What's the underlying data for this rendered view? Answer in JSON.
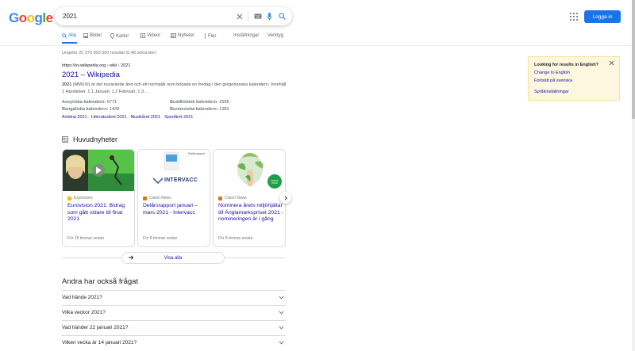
{
  "header": {
    "logo": [
      "G",
      "o",
      "o",
      "g",
      "l",
      "e"
    ],
    "logo_colors": [
      "#4285f4",
      "#ea4335",
      "#fbbc05",
      "#4285f4",
      "#34a853",
      "#ea4335"
    ],
    "query": "2021",
    "login_label": "Logga in"
  },
  "tabs": {
    "all": "Alla",
    "images": "Bilder",
    "maps": "Kartor",
    "videos": "Videor",
    "news": "Nyheter",
    "more": "Fler",
    "settings": "Inställningar",
    "tools": "Verktyg"
  },
  "stats": "Ungefär 25 270 000 000 resultat (0,48 sekunder)",
  "result": {
    "cite": "https://sv.wikipedia.org › wiki › 2021",
    "title": "2021 – Wikipedia",
    "snippet_bold": "2021",
    "snippet": " (MMXXI) är det nuvarande året och ett normalår som började en fredag i den gregorianska kalendern. Innehåll. 1 Händelser. 1.1 Januari; 1.2 Februari; 1.3 ...",
    "facts": [
      {
        "k": "Assyriska kalendern:",
        "v": "6771"
      },
      {
        "k": "Buddhistisk kalendern:",
        "v": "2565"
      },
      {
        "k": "Bengaliska kalendern:",
        "v": "1428"
      },
      {
        "k": "Burmesiska kalendern:",
        "v": "1383"
      }
    ],
    "sitelinks": [
      "Avlidna 2021",
      "Litteraturåret 2021",
      "Musikåret 2021",
      "Sportåret 2021"
    ],
    "sep": " · "
  },
  "top_stories": {
    "title": "Huvudnyheter",
    "cards": [
      {
        "source": "Expressen",
        "title": "Eurovision 2021: Bidrag som gått vidare till final 2021",
        "time": "För 15 timmar sedan"
      },
      {
        "source": "Cision News",
        "title": "Delårsrapport januari – mars 2021 - Intervacc",
        "time": "För 8 timmar sedan",
        "thumb_text": "INTERVACC",
        "thumb_small": "Delårsrapport"
      },
      {
        "source": "Cision News",
        "title": "Nominera årets miljöhjältar till Änglamarkspriset 2021 - nomineringen är i gång",
        "time": "För 8 timmar sedan"
      }
    ],
    "view_all": "Visa alla"
  },
  "paa": {
    "title": "Andra har också frågat",
    "questions": [
      "Vad hände 2021?",
      "Vilka veckor 2021?",
      "Vad händer 22 januari 2021?",
      "Vilken vecka är 14 januari 2021?"
    ]
  },
  "lang_box": {
    "heading": "Looking for results in English?",
    "change": "Change to English",
    "keep": "Fortsätt på svenska",
    "settings": "Språkinställningar"
  }
}
